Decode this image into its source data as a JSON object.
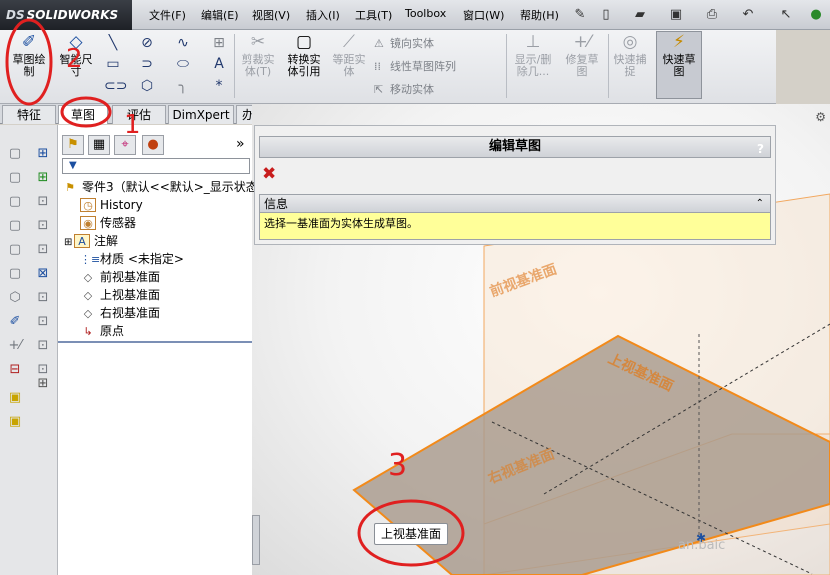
{
  "app": {
    "logo_text": "SOLIDWORKS",
    "logo_mark": "DS"
  },
  "menu": [
    "文件(F)",
    "编辑(E)",
    "视图(V)",
    "插入(I)",
    "工具(T)",
    "Toolbox",
    "窗口(W)",
    "帮助(H)"
  ],
  "ribbon": {
    "sketch_label": "草图绘\n制",
    "smart_dim_label": "智能尺\n寸",
    "trim_label": "剪裁实\n体(T)",
    "convert_label": "转换实\n体引用",
    "offset_label": "等距实\n体",
    "mirror_label": "镜向实体",
    "linear_pattern_label": "线性草图阵列",
    "move_label": "移动实体",
    "show_delete_label": "显示/删\n除几...",
    "repair_label": "修复草\n图",
    "quick_snap_label": "快速捕\n捉",
    "rapid_sketch_label": "快速草\n图"
  },
  "tabs": [
    "特征",
    "草图",
    "评估",
    "DimXpert",
    "办公室产品"
  ],
  "active_tab": "草图",
  "tree": {
    "root": "零件3（默认<<默认>_显示状态",
    "items": [
      "History",
      "传感器",
      "注解",
      "材质 <未指定>",
      "前视基准面",
      "上视基准面",
      "右视基准面",
      "原点"
    ]
  },
  "property_manager": {
    "title": "编辑草图",
    "help": "?",
    "info_title": "信息",
    "info_text": "选择一基准面为实体生成草图。"
  },
  "graphics": {
    "plane_labels": [
      "前视基准面",
      "上视基准面",
      "右视基准面"
    ],
    "tooltip_label": "上视基准面",
    "watermark": "an.baic"
  },
  "annotations": {
    "marker_1": "1",
    "marker_2": "2",
    "marker_3": "3"
  },
  "colors": {
    "plane_edge": "#f28a1a",
    "plane_fill": "#a89a8c",
    "annotation": "#e02020",
    "info_bg": "#ffff99"
  }
}
